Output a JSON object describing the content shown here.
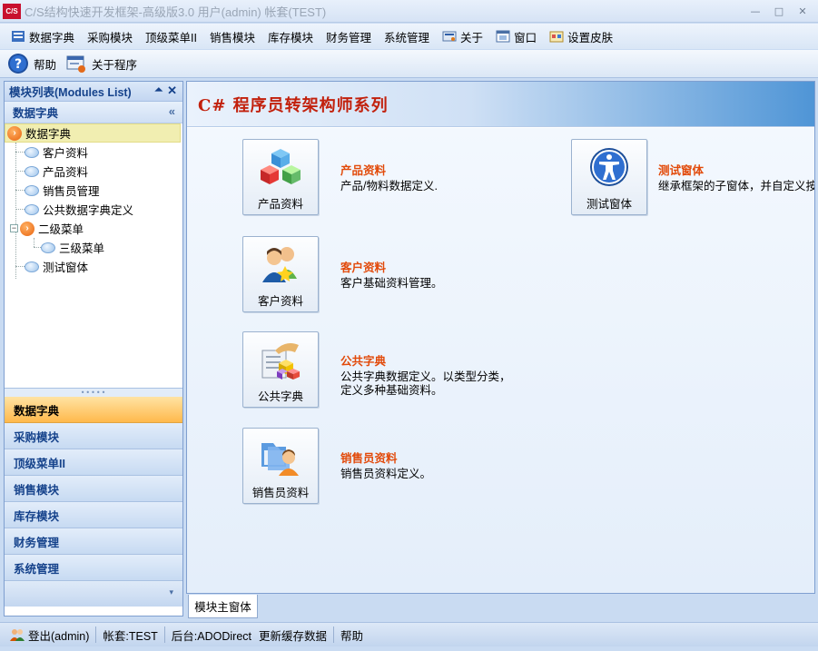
{
  "window": {
    "logo_text": "C/S",
    "title": "C/S结构快速开发框架-高级版3.0 用户(admin) 帐套(TEST)"
  },
  "menubar": {
    "items": [
      {
        "label": "数据字典",
        "icon": "data-dict-icon"
      },
      {
        "label": "采购模块"
      },
      {
        "label": "顶级菜单II"
      },
      {
        "label": "销售模块"
      },
      {
        "label": "库存模块"
      },
      {
        "label": "财务管理"
      },
      {
        "label": "系统管理"
      },
      {
        "label": "关于",
        "icon": "about-icon"
      },
      {
        "label": "窗口",
        "icon": "window-icon"
      },
      {
        "label": "设置皮肤",
        "icon": "skin-icon"
      }
    ]
  },
  "toolbar": {
    "help_label": "帮助",
    "about_label": "关于程序"
  },
  "leftpanel": {
    "title": "模块列表(Modules List)",
    "group_title": "数据字典",
    "tree": [
      {
        "label": "数据字典",
        "level": 0
      },
      {
        "label": "客户资料",
        "level": 1
      },
      {
        "label": "产品资料",
        "level": 1
      },
      {
        "label": "销售员管理",
        "level": 1
      },
      {
        "label": "公共数据字典定义",
        "level": 1
      },
      {
        "label": "二级菜单",
        "level": 1
      },
      {
        "label": "三级菜单",
        "level": 2
      },
      {
        "label": "测试窗体",
        "level": 1
      }
    ],
    "nav": [
      "数据字典",
      "采购模块",
      "顶级菜单II",
      "销售模块",
      "库存模块",
      "财务管理",
      "系统管理"
    ]
  },
  "main": {
    "banner": "C# 程序员转架构师系列",
    "modules": [
      {
        "button": "产品资料",
        "title": "产品资料",
        "desc": [
          "产品/物料数据定义."
        ]
      },
      {
        "button": "客户资料",
        "title": "客户资料",
        "desc": [
          "客户基础资料管理。"
        ]
      },
      {
        "button": "公共字典",
        "title": "公共字典",
        "desc": [
          "公共字典数据定义。以类型分类，",
          "定义多种基础资料。"
        ]
      },
      {
        "button": "销售员资料",
        "title": "销售员资料",
        "desc": [
          "销售员资料定义。"
        ]
      },
      {
        "button": "测试窗体",
        "title": "测试窗体",
        "desc": [
          "继承框架的子窗体，并自定义按"
        ]
      }
    ],
    "doc_tab": "模块主窗体"
  },
  "statusbar": {
    "logout": "登出(admin)",
    "account": "帐套:TEST",
    "backend": "后台:ADODirect",
    "refresh": "更新缓存数据",
    "help": "帮助"
  },
  "colors": {
    "accent_orange": "#e24a0a",
    "banner_red": "#c2200c",
    "selection": "#f1eeb1",
    "active_nav": "#ffb94c"
  }
}
